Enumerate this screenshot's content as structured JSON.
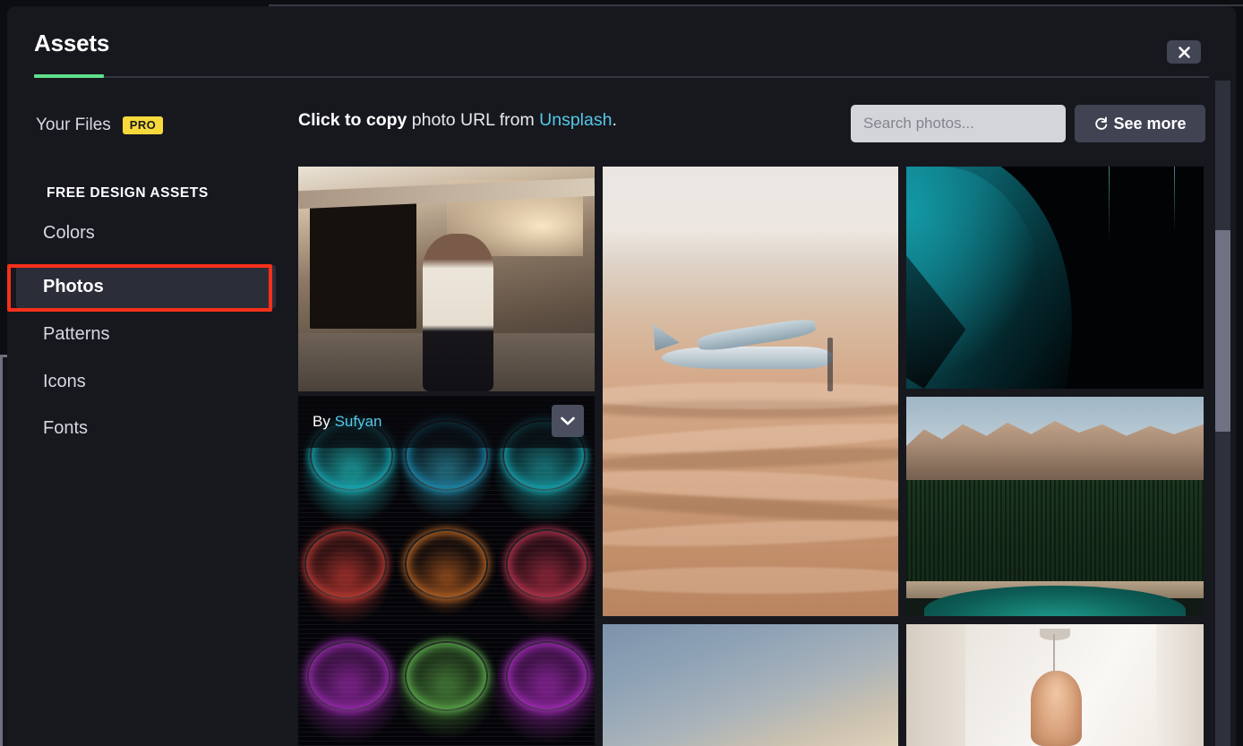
{
  "modal": {
    "title": "Assets",
    "close_label": "×",
    "accent_color": "#5fe08c"
  },
  "sidebar": {
    "your_files": {
      "label": "Your Files",
      "badge": "PRO"
    },
    "section_heading": "FREE DESIGN ASSETS",
    "items": [
      {
        "label": "Colors",
        "selected": false
      },
      {
        "label": "Photos",
        "selected": true
      },
      {
        "label": "Patterns",
        "selected": false
      },
      {
        "label": "Icons",
        "selected": false
      },
      {
        "label": "Fonts",
        "selected": false
      }
    ],
    "highlight_color": "#f5301b"
  },
  "content": {
    "hint": {
      "bold": "Click to copy",
      "middle": " photo URL from ",
      "link": "Unsplash",
      "period": "."
    },
    "search": {
      "placeholder": "Search photos...",
      "value": ""
    },
    "see_more_label": "See more",
    "see_more_icon": "refresh-icon"
  },
  "photos": [
    {
      "alt": "woman-at-sunset-warehouse",
      "credit": null
    },
    {
      "alt": "neon-circles-abstract",
      "credit": {
        "prefix": "By",
        "author": "Sufyan"
      }
    },
    {
      "alt": "plane-over-desert-dunes",
      "credit": null
    },
    {
      "alt": "teal-abstract-curves",
      "credit": null
    },
    {
      "alt": "mountains-forest-lake",
      "credit": null
    },
    {
      "alt": "blue-sky-gradient",
      "credit": null
    },
    {
      "alt": "interior-rattan-pendant-lamp",
      "credit": null
    }
  ]
}
